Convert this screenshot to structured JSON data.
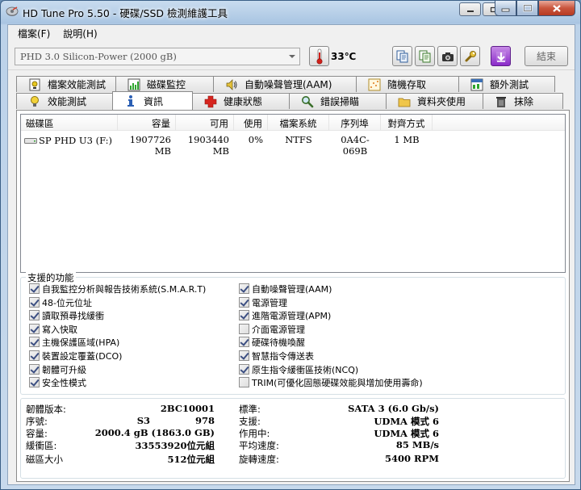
{
  "window": {
    "title": "HD Tune Pro 5.50 - 硬碟/SSD 檢測維護工具"
  },
  "menu": {
    "file": "檔案(F)",
    "help": "說明(H)"
  },
  "toolbar": {
    "drive_selected": "PHD 3.0 Silicon-Power (2000 gB)",
    "temperature": "33℃",
    "exit_label": "結束"
  },
  "tabs_row1": [
    {
      "label": "檔案效能測試"
    },
    {
      "label": "磁碟監控"
    },
    {
      "label": "自動噪聲管理(AAM)"
    },
    {
      "label": "隨機存取"
    },
    {
      "label": "額外測試"
    }
  ],
  "tabs_row2": [
    {
      "label": "效能測試"
    },
    {
      "label": "資訊"
    },
    {
      "label": "健康狀態"
    },
    {
      "label": "錯誤掃瞄"
    },
    {
      "label": "資料夾使用"
    },
    {
      "label": "抹除"
    }
  ],
  "partitions": {
    "columns": [
      "磁碟區",
      "容量",
      "可用",
      "使用",
      "檔案系統",
      "序列埠",
      "對齊方式"
    ],
    "rows": [
      {
        "volume": "SP PHD U3 (F:)",
        "capacity": "1907726 MB",
        "free": "1903440 MB",
        "used": "0%",
        "fs": "NTFS",
        "serial": "0A4C-069B",
        "alignment": "1 MB"
      }
    ]
  },
  "features": {
    "title": "支援的功能",
    "left": [
      {
        "label": "自我監控分析與報告技術系統(S.M.A.R.T)",
        "checked": true
      },
      {
        "label": "48-位元位址",
        "checked": true
      },
      {
        "label": "讀取預尋找緩衝",
        "checked": true
      },
      {
        "label": "寫入快取",
        "checked": true
      },
      {
        "label": "主機保護區域(HPA)",
        "checked": true
      },
      {
        "label": "裝置設定覆蓋(DCO)",
        "checked": true
      },
      {
        "label": "韌體可升級",
        "checked": true
      },
      {
        "label": "安全性模式",
        "checked": true
      }
    ],
    "right": [
      {
        "label": "自動噪聲管理(AAM)",
        "checked": true
      },
      {
        "label": "電源管理",
        "checked": true
      },
      {
        "label": "進階電源管理(APM)",
        "checked": true
      },
      {
        "label": "介面電源管理",
        "checked": false
      },
      {
        "label": "硬碟待機喚醒",
        "checked": true
      },
      {
        "label": "智慧指令傳送表",
        "checked": true
      },
      {
        "label": "原生指令緩衝區技術(NCQ)",
        "checked": true
      },
      {
        "label": "TRIM(可優化固態硬碟效能與增加使用壽命)",
        "checked": false
      }
    ]
  },
  "info": {
    "firmware_label": "韌體版本:",
    "firmware_value": "2BC10001",
    "serial_label": "序號:",
    "serial_value_a": "S3",
    "serial_value_b": "978",
    "capacity_label": "容量:",
    "capacity_value": "2000.4 gB (1863.0 GB)",
    "buffer_label": "緩衝區:",
    "buffer_value": "33553920位元組",
    "sector_label": "磁區大小",
    "sector_value": "512位元組",
    "standard_label": "標準:",
    "standard_value": "SATA 3 (6.0 Gb/s)",
    "support_label": "支援:",
    "support_value": "UDMA 模式 6",
    "active_label": "作用中:",
    "active_value": "UDMA 模式 6",
    "avg_speed_label": "平均速度:",
    "avg_speed_value": "85 MB/s",
    "rotation_label": "旋轉速度:",
    "rotation_value": "5400 RPM"
  },
  "colors": {
    "titlebar": "#a9c5e2",
    "close_button": "#c9553d",
    "checkbox_tick": "#3c4f82"
  }
}
